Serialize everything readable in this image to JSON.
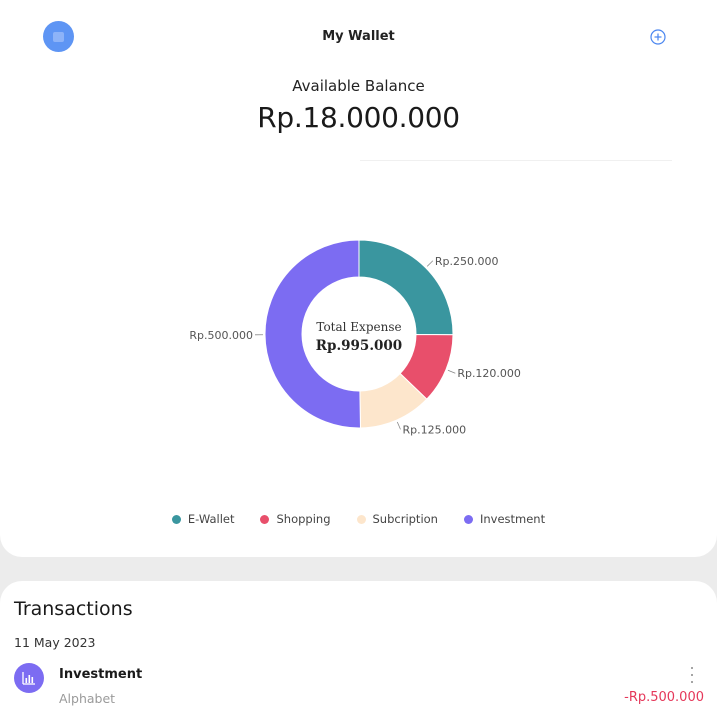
{
  "header": {
    "title": "My Wallet",
    "avatar_icon": "wallet-avatar-icon",
    "add_icon": "plus-circle-icon"
  },
  "balance": {
    "label": "Available Balance",
    "amount": "Rp.18.000.000"
  },
  "chart_data": {
    "type": "pie",
    "title": "",
    "center_title": "Total Expense",
    "center_value": "Rp.995.000",
    "categories": [
      "E-Wallet",
      "Shopping",
      "Subcription",
      "Investment"
    ],
    "values": [
      250000,
      120000,
      125000,
      500000
    ],
    "labels": [
      "Rp.250.000",
      "Rp.120.000",
      "Rp.125.000",
      "Rp.500.000"
    ],
    "colors": [
      "#3a969f",
      "#e84f6b",
      "#fde6cc",
      "#7c6cf2"
    ],
    "legend": "bottom"
  },
  "transactions": {
    "title": "Transactions",
    "date": "11 May 2023",
    "items": [
      {
        "name": "Investment",
        "sub": "Alphabet",
        "amount": "-Rp.500.000",
        "icon": "bar-chart-icon",
        "icon_color": "#7c6cf2",
        "more_icon": "more-vertical-icon"
      }
    ]
  }
}
